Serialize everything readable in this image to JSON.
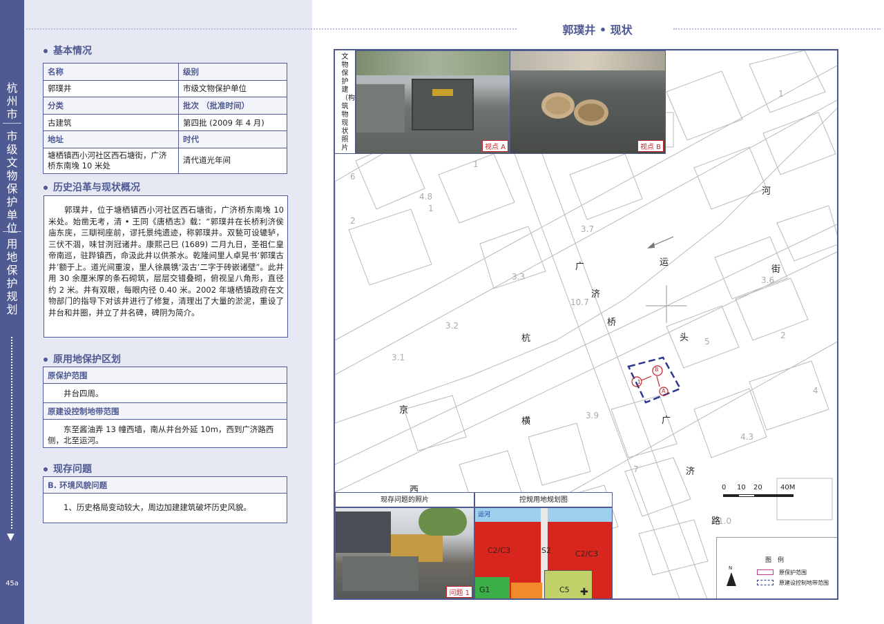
{
  "side": {
    "city": "杭州市",
    "category": "市级文物保护单位",
    "section": "用地保护规划",
    "page_number": "45a"
  },
  "header": {
    "title": "郭璞井 • 现状"
  },
  "basic": {
    "heading": "基本情况",
    "rows": [
      {
        "h1": "名称",
        "h2": "级别"
      },
      {
        "v1": "郭璞井",
        "v2": "市级文物保护单位"
      },
      {
        "h1": "分类",
        "h2": "批次 （批准时间）"
      },
      {
        "v1": "古建筑",
        "v2": "第四批 (2009 年 4 月)"
      },
      {
        "h1": "地址",
        "h2": "时代"
      },
      {
        "v1": "塘栖镇西小河社区西石塘街，广济桥东南堍 10 米处",
        "v2": "清代道光年间"
      }
    ]
  },
  "history": {
    "heading": "历史沿革与现状概况",
    "text": "郭璞井，位于塘栖镇西小河社区西石塘街，广济桥东南堍 10 米处。始凿无考，清 • 王同《唐栖志》载：“郭璞井在长桥利济侯庙东庑，三瞓祠座前，谬托景纯遗迹，称郭璞井。双甃可设辘轳，三伏不涸，味甘洌冠诸井。康熙己巳 (1689) 二月九日，圣祖仁皇帝南巡，驻跸镇西，命汲此井以供茶水。乾隆间里人卓晃书‘郭璞古井’额于上。道光间重浚，里人徐晨镌‘汲古’二字于砖嵌诸壁”。此井用 30 余厘米厚的条石砌筑，层层交错叠砌，俯视呈八角形，直径约 2 米。井有双眼，每眼内径 0.40 米。2002 年塘栖镇政府在文物部门的指导下对该井进行了修复，清理出了大量的淤泥，重设了井台和井圈，并立了井名碑，碑阴为简介。"
  },
  "original": {
    "heading": "原用地保护区划",
    "protect_label": "原保护范围",
    "protect_text": "井台四周。",
    "control_label": "原建设控制地带范围",
    "control_text": "东至酱油弄 13 幢西墙，南从井台外延 10m，西到广济路西侧，北至运河。"
  },
  "issues": {
    "heading": "现存问题",
    "type_label": "B. 环境风貌问题",
    "text": "1、历史格局变动较大，周边加建建筑破坏历史风貌。"
  },
  "map": {
    "photo_title": "文物保护建（构）筑物现状照片",
    "view_a": "视点 A",
    "view_b": "视点 B",
    "labels": {
      "he": "河",
      "yun": "运",
      "jie": "街",
      "guang1": "广",
      "ji1": "济",
      "qiao": "桥",
      "hang": "杭",
      "tou": "头",
      "jing": "京",
      "heng": "横",
      "guang2": "广",
      "ji2": "济",
      "xi": "西",
      "lu": "路"
    },
    "markers": {
      "m1": "1",
      "mB": "B",
      "mA": "A"
    },
    "numbers": [
      "1",
      "2",
      "4.8",
      "1",
      "3.7",
      "3.3",
      "10.7",
      "3.2",
      "3.1",
      "1",
      "3.9",
      "2",
      "4.3",
      "3.6",
      "5",
      "6",
      "7",
      "4",
      "1.0"
    ],
    "scale": {
      "ticks": [
        "0",
        "10",
        "20",
        "40M"
      ]
    },
    "issue_photo_title": "现存问题的照片",
    "issue_tag": "问题 1",
    "plan_title": "控规用地规划图",
    "plan_labels": {
      "c1": "C2/C3",
      "s2": "S2",
      "c2": "C2/C3",
      "g1": "G1",
      "c5": "C5",
      "river": "运河"
    },
    "legend": {
      "title": "图　例",
      "item1": "原保护范围",
      "item2": "原建设控制地带范围"
    }
  }
}
